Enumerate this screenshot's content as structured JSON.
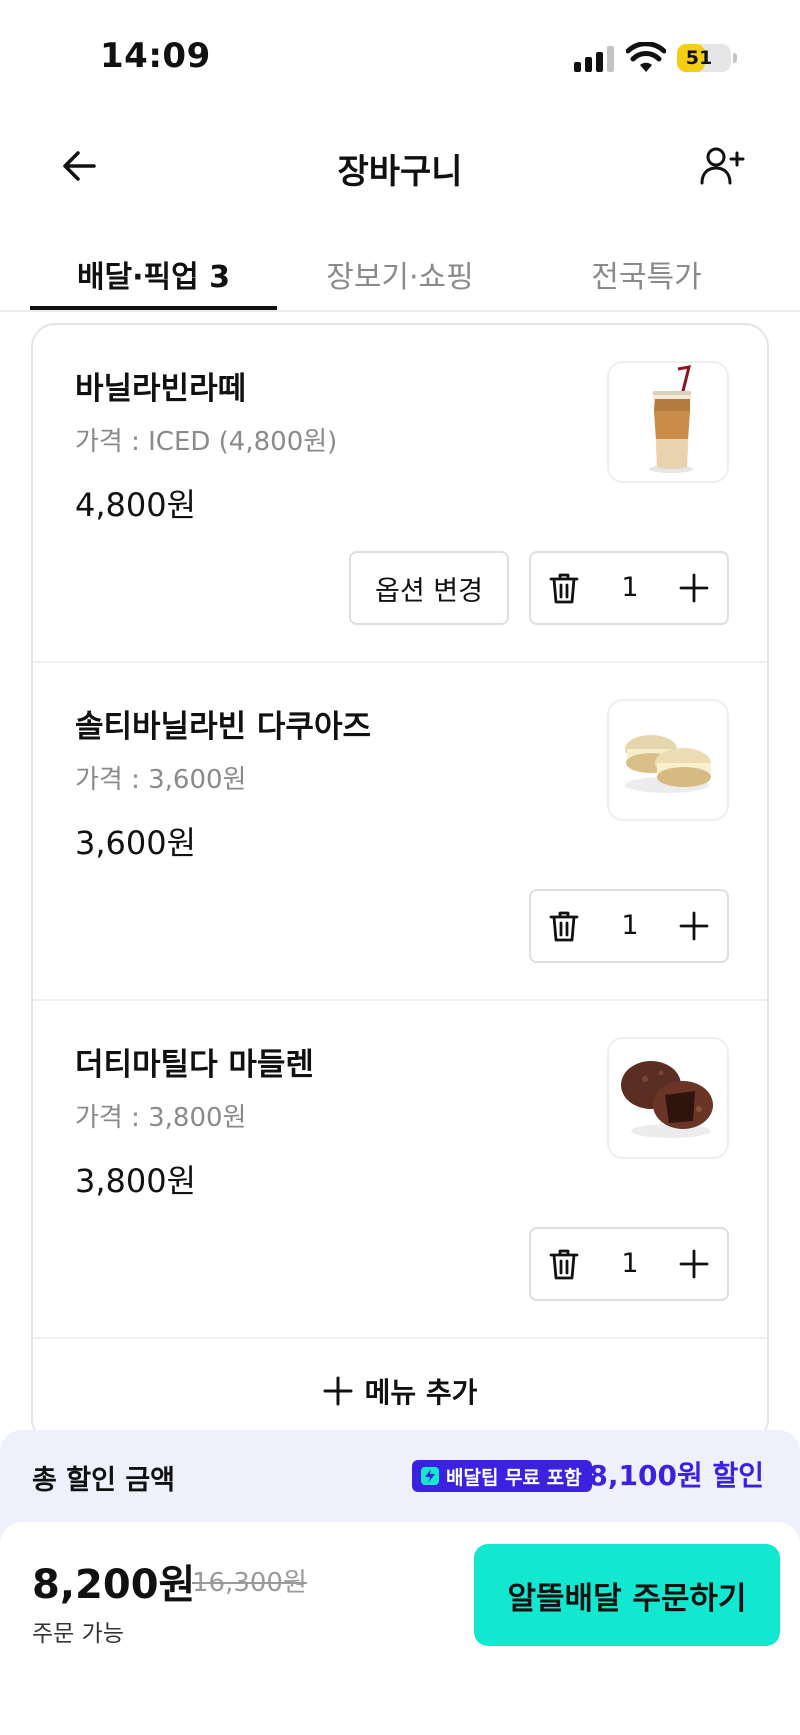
{
  "status_bar": {
    "time": "14:09",
    "battery_percent": 51,
    "battery_label": "51",
    "signal_icon": "cellular-signal-icon",
    "wifi_icon": "wifi-icon",
    "battery_color": "#f5cd14"
  },
  "header": {
    "title": "장바구니",
    "back_icon": "arrow-left-icon",
    "add_user_icon": "person-plus-icon"
  },
  "tabs": [
    {
      "label": "배달·픽업 3",
      "active": true
    },
    {
      "label": "장보기·쇼핑",
      "active": false
    },
    {
      "label": "전국특가",
      "active": false
    }
  ],
  "cart": {
    "items": [
      {
        "name": "바닐라빈라떼",
        "option": "가격 : ICED (4,800원)",
        "price": "4,800원",
        "quantity": "1",
        "image_icon": "iced-latte-image",
        "option_button": "옵션 변경"
      },
      {
        "name": "솔티바닐라빈 다쿠아즈",
        "option": "가격 : 3,600원",
        "price": "3,600원",
        "quantity": "1",
        "image_icon": "dacquoise-image"
      },
      {
        "name": "더티마틸다 마들렌",
        "option": "가격 : 3,800원",
        "price": "3,800원",
        "quantity": "1",
        "image_icon": "chocolate-madeleine-image"
      }
    ],
    "add_menu_label": "메뉴 추가"
  },
  "discount": {
    "label": "총 할인 금액",
    "badge": "배달팁 무료 포함",
    "amount": "8,100원 할인",
    "accent_color": "#3b22e0"
  },
  "order": {
    "final_price": "8,200원",
    "original_price": "16,300원",
    "status": "주문 가능",
    "button_label": "알뜰배달 주문하기",
    "button_color": "#12e8d0"
  }
}
